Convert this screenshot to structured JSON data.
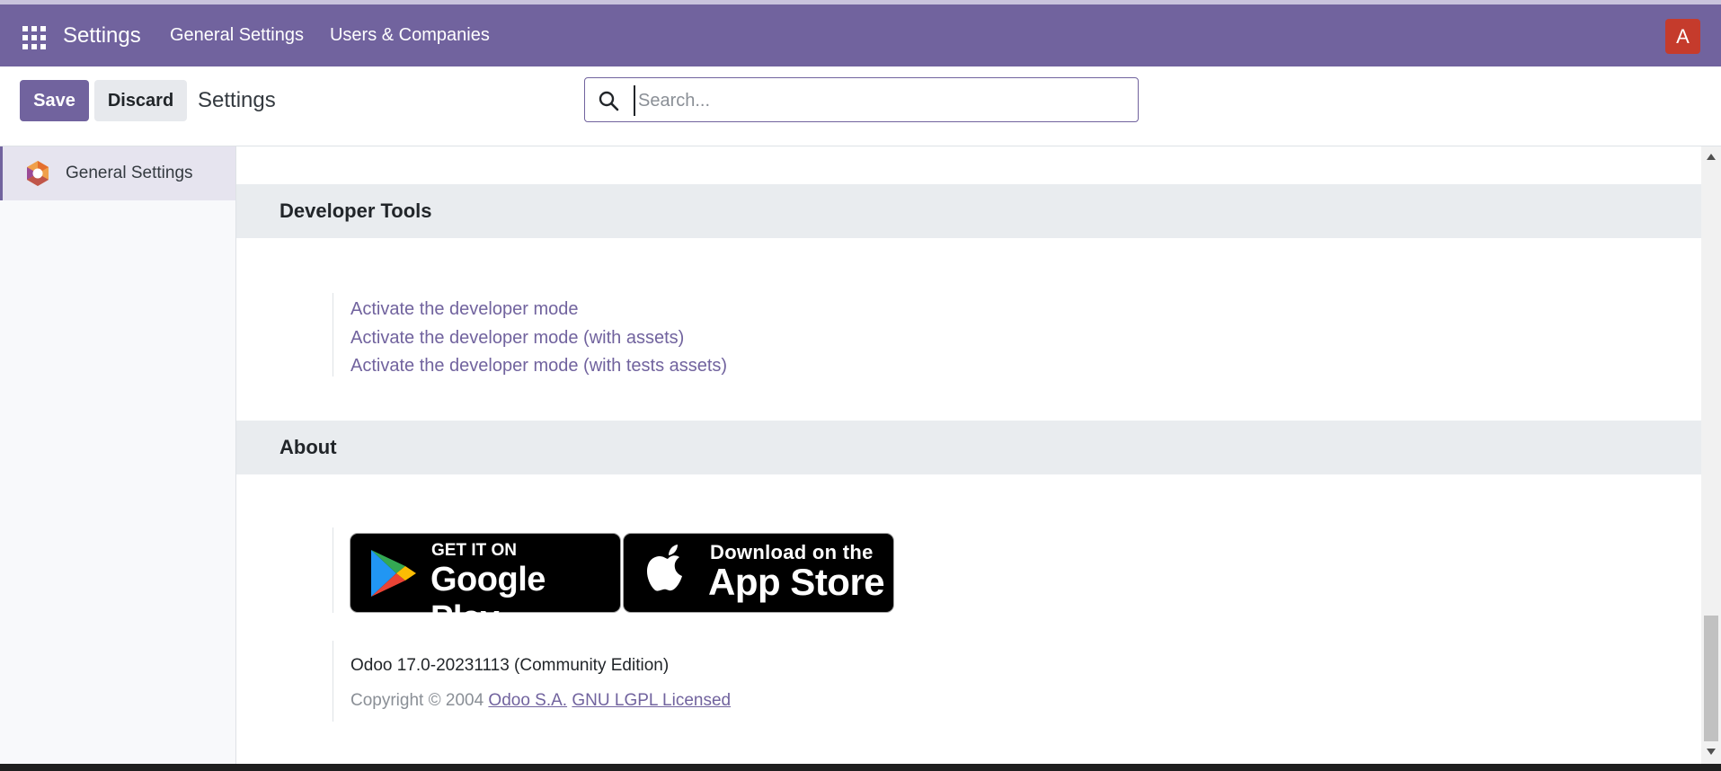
{
  "navbar": {
    "app_title": "Settings",
    "menu": [
      "General Settings",
      "Users & Companies"
    ],
    "avatar_initial": "A",
    "color": "#71639e"
  },
  "control_panel": {
    "save_label": "Save",
    "discard_label": "Discard",
    "breadcrumb": "Settings",
    "search_placeholder": "Search..."
  },
  "sidebar": {
    "items": [
      {
        "label": "General Settings",
        "icon": "odoo-settings-icon",
        "active": true
      }
    ]
  },
  "sections": {
    "developer": {
      "title": "Developer Tools",
      "links": [
        "Activate the developer mode",
        "Activate the developer mode (with assets)",
        "Activate the developer mode (with tests assets)"
      ]
    },
    "about": {
      "title": "About",
      "google_play": {
        "small": "GET IT ON",
        "big": "Google Play"
      },
      "app_store": {
        "small": "Download on the",
        "big": "App Store"
      },
      "version": "Odoo 17.0-20231113 (Community Edition)",
      "copyright_prefix": "Copyright © 2004",
      "company_link": "Odoo S.A.",
      "license_link": "GNU LGPL Licensed"
    }
  }
}
